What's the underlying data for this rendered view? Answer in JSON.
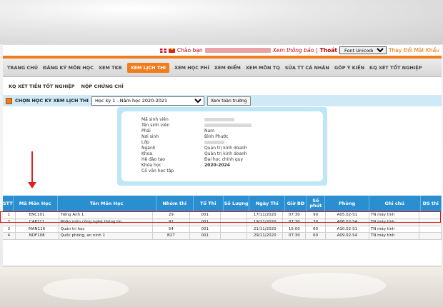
{
  "topbar": {
    "greeting": "Chào bạn",
    "view_info": "Xem thông báo",
    "separator": "|",
    "logout": "Thoát",
    "font_select": "Font Unicode",
    "change_password": "Thay Đổi Mật Khẩu"
  },
  "menu": {
    "items": [
      {
        "label": "TRANG CHỦ"
      },
      {
        "label": "ĐĂNG KÝ MÔN HỌC"
      },
      {
        "label": "XEM TKB"
      },
      {
        "label": "XEM LỊCH THI"
      },
      {
        "label": "XEM HỌC PHÍ"
      },
      {
        "label": "XEM ĐIỂM"
      },
      {
        "label": "XEM MÔN TQ"
      },
      {
        "label": "SỬA TT CÁ NHÂN"
      },
      {
        "label": "GÓP Ý KIẾN"
      },
      {
        "label": "KQ XÉT TỐT NGHIỆP"
      }
    ],
    "active_index": 3
  },
  "submenu": {
    "items": [
      {
        "label": "KQ XÉT TIỀN TỐT NGHIỆP"
      },
      {
        "label": "NỘP CHỨNG CHỈ"
      }
    ]
  },
  "semester": {
    "label": "CHỌN HỌC KỲ XEM LỊCH THI",
    "selected": "Học kỳ 1 - Năm học 2020-2021",
    "button": "Xem toàn trường"
  },
  "student": {
    "rows": [
      {
        "label": "Mã sinh viên",
        "value": ""
      },
      {
        "label": "Tên sinh viên",
        "value": ""
      },
      {
        "label": "Phái",
        "value": "Nam"
      },
      {
        "label": "Nơi sinh",
        "value": "Bình Phước"
      },
      {
        "label": "Lớp",
        "value": ""
      },
      {
        "label": "Ngành",
        "value": "Quản trị kinh doanh"
      },
      {
        "label": "Khoa",
        "value": "Quản trị kinh doanh"
      },
      {
        "label": "Hệ đào tạo",
        "value": "Đại học chính quy"
      },
      {
        "label": "Khóa học",
        "value": "2020-2024"
      },
      {
        "label": "Cố vấn học tập",
        "value": ""
      }
    ]
  },
  "table": {
    "headers": [
      "STT",
      "Mã Môn Học",
      "Tên Môn Học",
      "Nhóm thi",
      "Tổ Thi",
      "Số Lượng",
      "Ngày Thi",
      "Giờ BĐ",
      "Số phút",
      "Phòng",
      "Ghi chú",
      "DS thi"
    ],
    "rows": [
      [
        "1",
        "ENC101",
        "Tiếng Anh 1",
        "29",
        "001",
        "",
        "17/11/2020",
        "07:30",
        "90",
        "A05.02-S1",
        "TN máy tính",
        ""
      ],
      [
        "2",
        "CAP211",
        "Nhập môn công nghệ thông tin",
        "92",
        "001",
        "",
        "19/11/2020",
        "07:30",
        "30",
        "A06.02-S4",
        "TN máy tính",
        ""
      ],
      [
        "3",
        "MAN116",
        "Quản trị học",
        "54",
        "001",
        "",
        "21/11/2020",
        "15:00",
        "60",
        "A10.02-S1",
        "TN máy tính",
        ""
      ],
      [
        "4",
        "NDF108",
        "Quốc phòng, an ninh 1",
        "B27",
        "001",
        "",
        "29/11/2020",
        "07:30",
        "60",
        "A09.02-S4",
        "TN máy tính",
        ""
      ]
    ]
  },
  "colors": {
    "accent": "#f07c1a",
    "header_blue": "#2a8fd0",
    "annotation_red": "#e02020"
  }
}
